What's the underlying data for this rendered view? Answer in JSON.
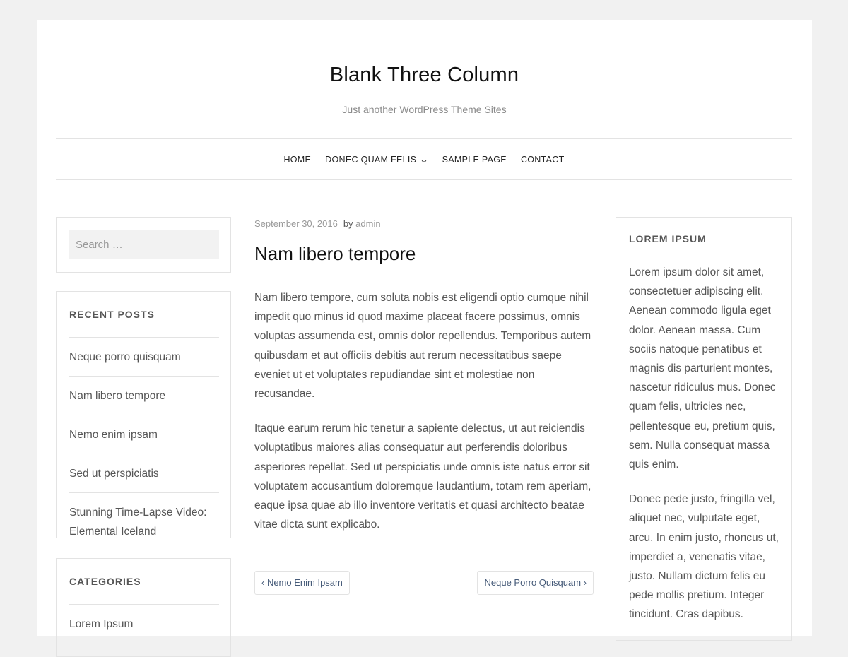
{
  "site": {
    "title": "Blank Three Column",
    "description": "Just another WordPress Theme Sites"
  },
  "nav": {
    "items": [
      "HOME",
      "DONEC QUAM FELIS",
      "SAMPLE PAGE",
      "CONTACT"
    ],
    "dropdown_icon": "chevron-down-icon"
  },
  "search": {
    "placeholder": "Search …"
  },
  "recent_posts": {
    "title": "RECENT POSTS",
    "items": [
      "Neque porro quisquam",
      "Nam libero tempore",
      "Nemo enim ipsam",
      "Sed ut perspiciatis",
      "Stunning Time-Lapse Video: Elemental Iceland"
    ]
  },
  "categories": {
    "title": "CATEGORIES",
    "items": [
      "Lorem Ipsum"
    ]
  },
  "post": {
    "date": "September 30, 2016",
    "by": "by",
    "author": "admin",
    "title": "Nam libero tempore",
    "paragraphs": [
      "Nam libero tempore, cum soluta nobis est eligendi optio cumque nihil impedit quo minus id quod maxime placeat facere possimus, omnis voluptas assumenda est, omnis dolor repellendus. Temporibus autem quibusdam et aut officiis debitis aut rerum necessitatibus saepe eveniet ut et voluptates repudiandae sint et molestiae non recusandae.",
      "Itaque earum rerum hic tenetur a sapiente delectus, ut aut reiciendis voluptatibus maiores alias consequatur aut perferendis doloribus asperiores repellat. Sed ut perspiciatis unde omnis iste natus error sit voluptatem accusantium doloremque laudantium, totam rem aperiam, eaque ipsa quae ab illo inventore veritatis et quasi architecto beatae vitae dicta sunt explicabo."
    ],
    "prev_label": "‹ Nemo Enim Ipsam",
    "next_label": "Neque Porro Quisquam ›"
  },
  "right_widget": {
    "title": "LOREM IPSUM",
    "paragraphs": [
      "Lorem ipsum dolor sit amet, consectetuer adipiscing elit. Aenean commodo ligula eget dolor. Aenean massa. Cum sociis natoque penatibus et magnis dis parturient montes, nascetur ridiculus mus. Donec quam felis, ultricies nec, pellentesque eu, pretium quis, sem. Nulla consequat massa quis enim.",
      "Donec pede justo, fringilla vel, aliquet nec, vulputate eget, arcu. In enim justo, rhoncus ut, imperdiet a, venenatis vitae, justo. Nullam dictum felis eu pede mollis pretium. Integer tincidunt. Cras dapibus."
    ]
  }
}
